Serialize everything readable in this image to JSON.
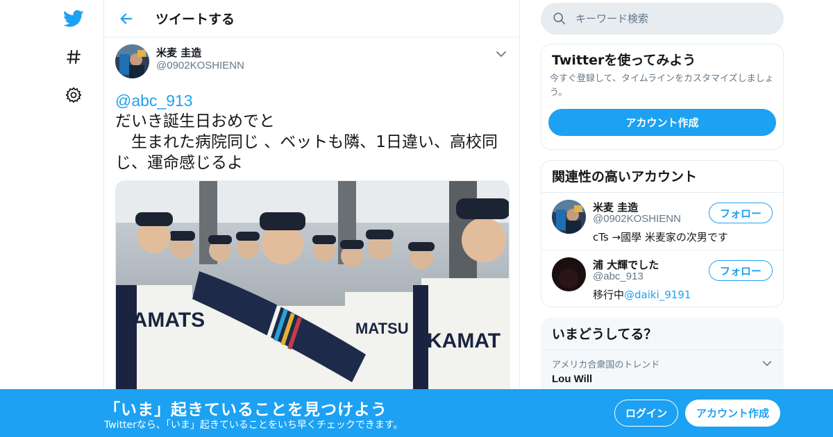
{
  "colors": {
    "accent": "#1da1f2",
    "border": "#e6ecf0",
    "muted": "#657786",
    "text": "#14171a"
  },
  "nav": {
    "icons": [
      "twitter-bird-icon",
      "hashtag-icon",
      "gear-icon"
    ]
  },
  "header": {
    "title": "ツイートする"
  },
  "tweet": {
    "author_name": "米麦 圭造",
    "author_handle": "@0902KOSHIENN",
    "mention": "@abc_913",
    "line1": "だいき誕生日おめでと",
    "line2": "　生まれた病院同じ 、ベットも隣、1日違い、高校同じ、運命感じるよ",
    "media": {
      "type": "photo"
    }
  },
  "search": {
    "placeholder": "キーワード検索"
  },
  "signup_card": {
    "title": "Twitterを使ってみよう",
    "subtitle": "今すぐ登録して、タイムラインをカスタマイズしましょう。",
    "button": "アカウント作成"
  },
  "related": {
    "title": "関連性の高いアカウント",
    "accounts": [
      {
        "name": "米麦 圭造",
        "handle": "@0902KOSHIENN",
        "bio": "cTs →國學 米麦家の次男です",
        "bio_mention": "",
        "button": "フォロー"
      },
      {
        "name": "浦 大輝でした",
        "handle": "@abc_913",
        "bio": "移行中",
        "bio_mention": "@daiki_9191",
        "button": "フォロー"
      }
    ]
  },
  "trends": {
    "title": "いまどうしてる？",
    "items": [
      {
        "meta": "アメリカ合衆国のトレンド",
        "name": "Lou Will"
      }
    ]
  },
  "bottom": {
    "title": "「いま」起きていることを見つけよう",
    "subtitle": "Twitterなら、「いま」起きていることをいち早くチェックできます。",
    "login": "ログイン",
    "signup": "アカウント作成"
  }
}
